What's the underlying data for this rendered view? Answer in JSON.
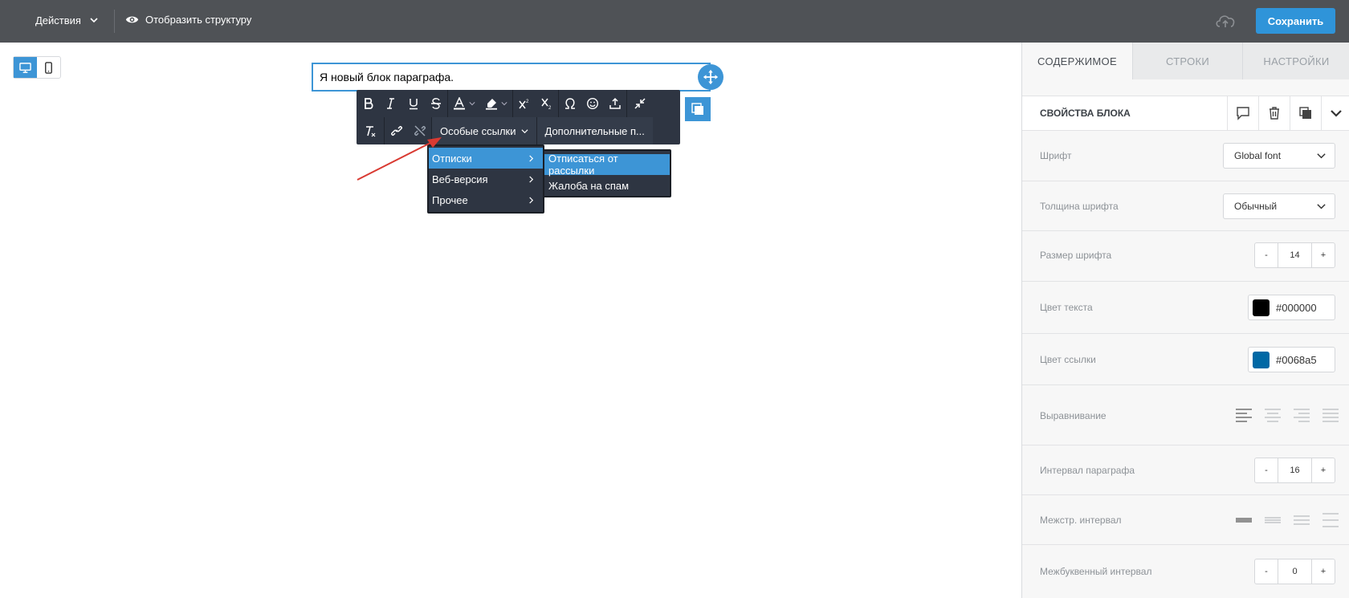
{
  "topbar": {
    "actions_label": "Действия",
    "structure_label": "Отобразить структуру",
    "save_label": "Сохранить"
  },
  "canvas": {
    "paragraph_text": "Я новый блок параграфа."
  },
  "toolbar": {
    "special_links_label": "Особые ссылки",
    "more_label": "Дополнительные п..."
  },
  "menu": {
    "items": [
      {
        "label": "Отписки"
      },
      {
        "label": "Веб-версия"
      },
      {
        "label": "Прочее"
      }
    ],
    "submenu": [
      {
        "label": "Отписаться от рассылки"
      },
      {
        "label": "Жалоба на спам"
      }
    ]
  },
  "panel": {
    "tabs": [
      {
        "label": "СОДЕРЖИМОЕ"
      },
      {
        "label": "СТРОКИ"
      },
      {
        "label": "НАСТРОЙКИ"
      }
    ],
    "block_props_title": "СВОЙСТВА БЛОКА",
    "font": {
      "label": "Шрифт",
      "value": "Global font"
    },
    "font_weight": {
      "label": "Толщина шрифта",
      "value": "Обычный"
    },
    "font_size": {
      "label": "Размер шрифта",
      "value": "14",
      "minus": "-",
      "plus": "+"
    },
    "text_color": {
      "label": "Цвет текста",
      "value": "#000000",
      "swatch": "#000000"
    },
    "link_color": {
      "label": "Цвет ссылки",
      "value": "#0068a5",
      "swatch": "#0068a5"
    },
    "alignment": {
      "label": "Выравнивание"
    },
    "paragraph_spacing": {
      "label": "Интервал параграфа",
      "value": "16",
      "minus": "-",
      "plus": "+"
    },
    "line_height": {
      "label": "Межстр. интервал"
    },
    "letter_spacing": {
      "label": "Межбуквенный интервал",
      "value": "0",
      "minus": "-",
      "plus": "+"
    }
  },
  "colors": {
    "accent": "#3d95d6",
    "topbar": "#4f5256",
    "toolbar": "#2e3542",
    "annotation_arrow": "#d93a32"
  }
}
